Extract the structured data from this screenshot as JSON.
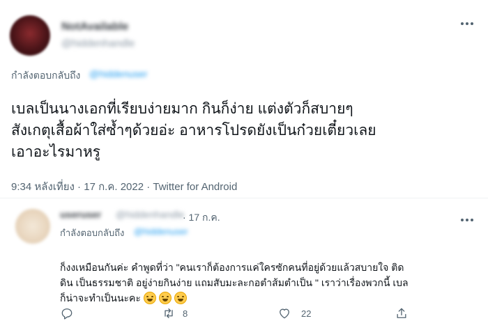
{
  "main_tweet": {
    "replying_label": "กำลังตอบกลับถึง",
    "body": "เบลเป็นนางเอกที่เรียบง่ายมาก กินก็ง่าย แต่งตัวก็สบายๆ\nสังเกตุเสื้อผ้าใส่ซ้ำๆด้วยอ่ะ อาหารโปรดยังเป็นก๋วยเตี๋ยวเลย\nเอาอะไรมาหรู",
    "meta": "9:34 หลังเที่ยง · 17 ก.ค. 2022 · Twitter for Android"
  },
  "reply": {
    "date": "· 17 ก.ค.",
    "replying_label": "กำลังตอบกลับถึง",
    "body": "ก็งงเหมือนกันค่ะ คำพูดที่ว่า \"คนเราก็ต้องการแค่ใครซักคนที่อยู่ด้วยแล้วสบายใจ ติด\nดิน เป็นธรรมชาติ อยู่ง่ายกินง่าย แถมสับมะละกอตำส้มตำเป็น \" เราว่าเรื่องพวกนี้ เบล\nก็น่าจะทำเป็นนะคะ",
    "retweet_count": "8",
    "like_count": "22"
  },
  "icons": {
    "more": "more-dots-icon",
    "reply": "reply-icon",
    "retweet": "retweet-icon",
    "like": "heart-icon",
    "share": "share-icon",
    "emoji": "grinning-squinting-face-emoji"
  },
  "colors": {
    "link_blue": "#1d9bf0",
    "secondary_text": "#536471",
    "primary_text": "#0f1419"
  }
}
